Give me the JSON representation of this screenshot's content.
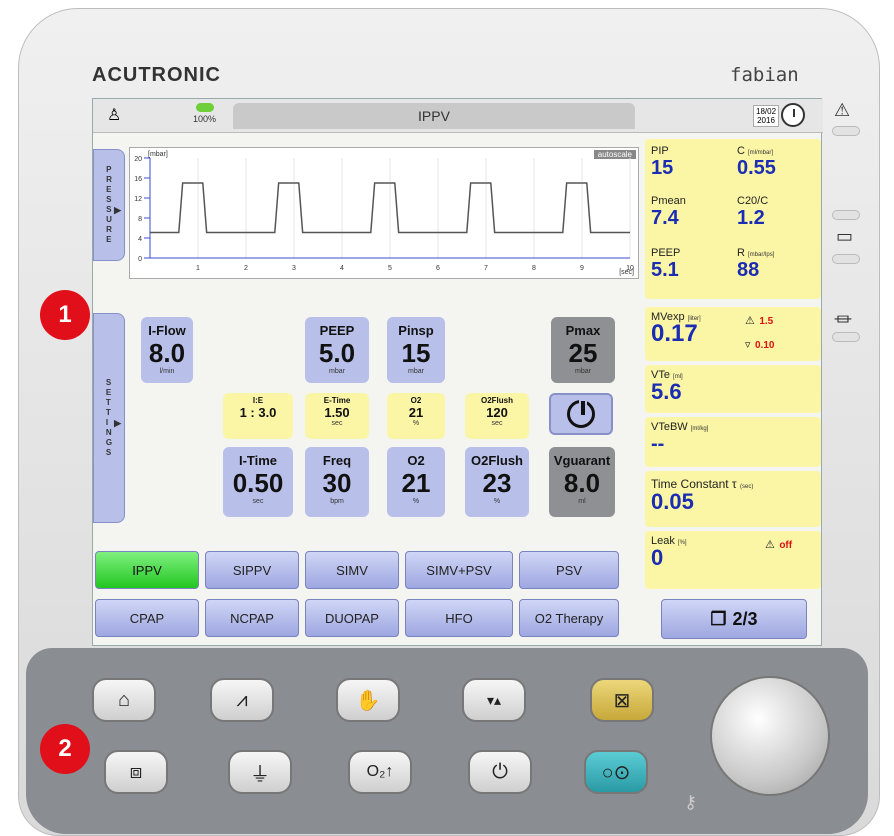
{
  "brand": "ACUTRONIC",
  "model": "fabian",
  "topbar": {
    "mode_title": "IPPV",
    "battery_pct": "100%",
    "date": "18/02\n2016"
  },
  "graph": {
    "tab_label": "PRESSURE",
    "unit": "[mbar]",
    "x_unit": "[sec]",
    "autoscale_label": "autoscale",
    "y_ticks": [
      "20",
      "16",
      "12",
      "8",
      "4",
      "0"
    ],
    "x_ticks": [
      "1",
      "2",
      "3",
      "4",
      "5",
      "6",
      "7",
      "8",
      "9",
      "10"
    ]
  },
  "settings": {
    "tab_label": "SETTINGS",
    "iflow": {
      "label": "I-Flow",
      "value": "8.0",
      "unit": "l/min"
    },
    "peep": {
      "label": "PEEP",
      "value": "5.0",
      "unit": "mbar"
    },
    "pinsp": {
      "label": "Pinsp",
      "value": "15",
      "unit": "mbar"
    },
    "pmax": {
      "label": "Pmax",
      "value": "25",
      "unit": "mbar"
    },
    "ie": {
      "label": "I:E",
      "value": "1 : 3.0",
      "unit": ""
    },
    "etime": {
      "label": "E-Time",
      "value": "1.50",
      "unit": "sec"
    },
    "o2small": {
      "label": "O2",
      "value": "21",
      "unit": "%"
    },
    "o2flush_small": {
      "label": "O2Flush",
      "value": "120",
      "unit": "sec"
    },
    "itime": {
      "label": "I-Time",
      "value": "0.50",
      "unit": "sec"
    },
    "freq": {
      "label": "Freq",
      "value": "30",
      "unit": "bpm"
    },
    "o2": {
      "label": "O2",
      "value": "21",
      "unit": "%"
    },
    "o2flush": {
      "label": "O2Flush",
      "value": "23",
      "unit": "%"
    },
    "vguarant": {
      "label": "Vguarant",
      "value": "8.0",
      "unit": "ml"
    }
  },
  "modes": {
    "row1": [
      "IPPV",
      "SIPPV",
      "SIMV",
      "SIMV+PSV",
      "PSV"
    ],
    "row2": [
      "CPAP",
      "NCPAP",
      "DUOPAP",
      "HFO",
      "O2 Therapy"
    ],
    "active": "IPPV"
  },
  "monitor": {
    "pip": {
      "label": "PIP",
      "value": "15"
    },
    "c": {
      "label": "C",
      "unit": "[ml/mbar]",
      "value": "0.55"
    },
    "pmean": {
      "label": "Pmean",
      "value": "7.4"
    },
    "c20c": {
      "label": "C20/C",
      "value": "1.2"
    },
    "peep": {
      "label": "PEEP",
      "value": "5.1"
    },
    "r": {
      "label": "R",
      "unit": "[mbar/lps]",
      "value": "88"
    },
    "mv": {
      "label": "MVexp",
      "unit": "[liter]",
      "value": "0.17",
      "hi": "1.5",
      "lo": "0.10"
    },
    "vte": {
      "label": "VTe",
      "unit": "[ml]",
      "value": "5.6"
    },
    "vtebw": {
      "label": "VTeBW",
      "unit": "[ml/kg]",
      "value": "--"
    },
    "tc": {
      "label": "Time Constant τ",
      "unit": "(sec)",
      "value": "0.05"
    },
    "leak": {
      "label": "Leak",
      "unit": "[%]",
      "value": "0",
      "alarm": "off"
    },
    "page": "2/3"
  },
  "badges": [
    "1",
    "2"
  ],
  "colors": {
    "active_mode": "#22c622",
    "mode_button": "#9ea7e0",
    "value_blue": "#1a2db3",
    "badge_red": "#e10f1a",
    "monitor_bg": "#fbf6a6"
  }
}
